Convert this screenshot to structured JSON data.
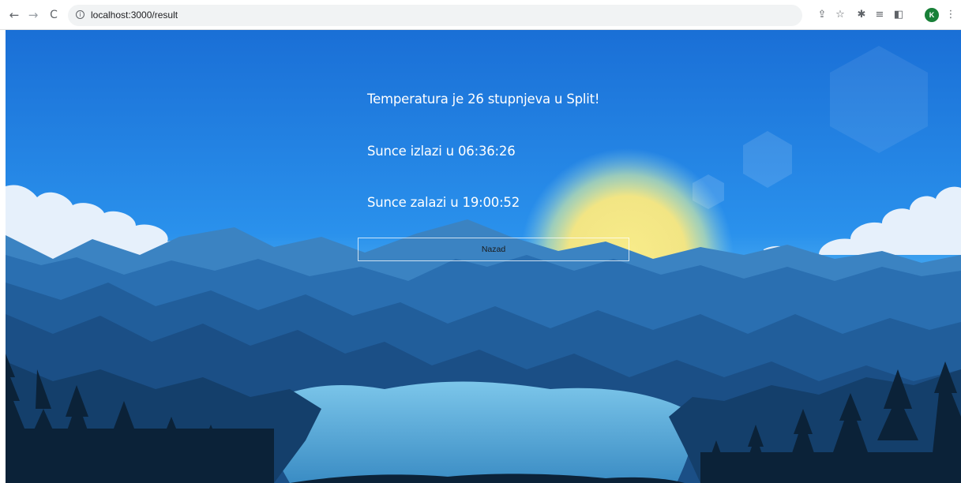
{
  "browser": {
    "url": "localhost:3000/result",
    "back_glyph": "←",
    "forward_glyph": "→",
    "reload_glyph": "C",
    "avatar_letter": "K"
  },
  "weather": {
    "temperature_line": "Temperatura je 26 stupnjeva u Split!",
    "sunrise_line": "Sunce izlazi u 06:36:26",
    "sunset_line": "Sunce zalazi u 19:00:52",
    "back_button_label": "Nazad"
  },
  "colors": {
    "sky_top": "#1c7ae0",
    "sky_mid": "#2b95ee",
    "sun": "#f4e98a",
    "cloud": "#e9f1fb",
    "mountain_far": "#2a6fb1",
    "mountain_mid": "#1d5a93",
    "mountain_near": "#143f6b",
    "lake": "#4a9fd3",
    "forest": "#0b2238"
  }
}
